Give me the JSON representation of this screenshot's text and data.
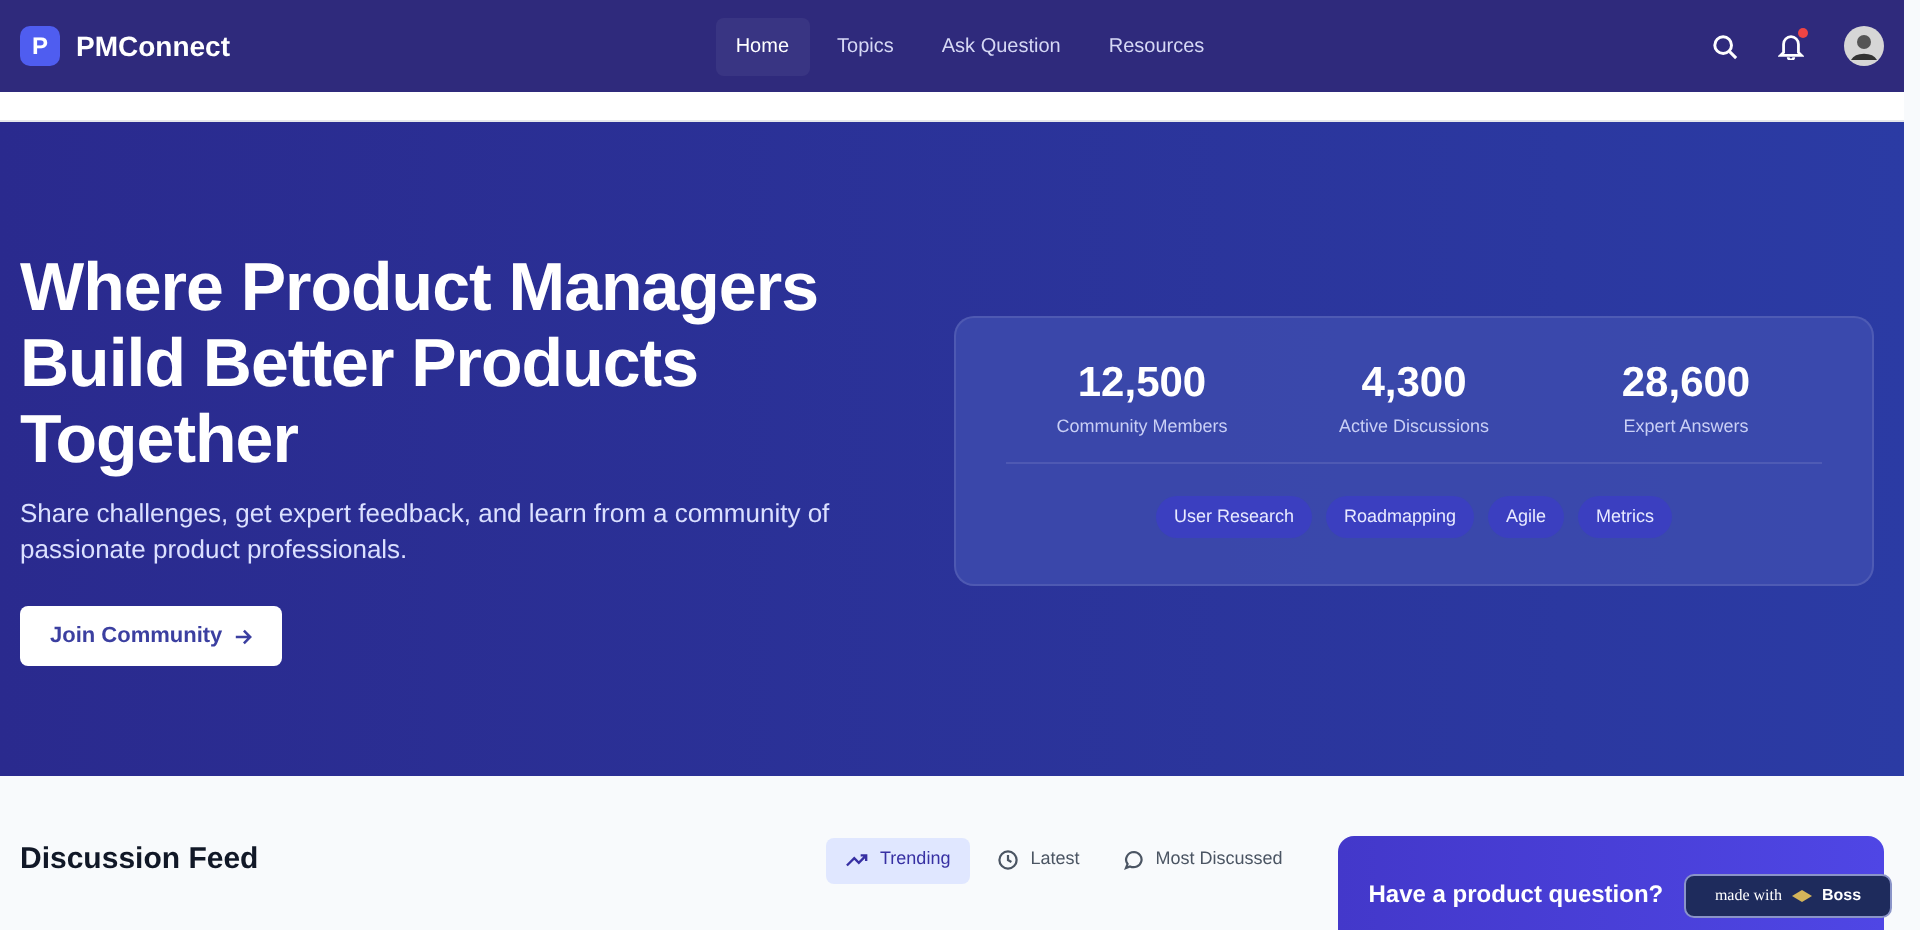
{
  "navbar": {
    "logo_letter": "P",
    "brand": "PMConnect",
    "links": [
      {
        "label": "Home",
        "selected": true
      },
      {
        "label": "Topics",
        "selected": false
      },
      {
        "label": "Ask Question",
        "selected": false
      },
      {
        "label": "Resources",
        "selected": false
      }
    ],
    "notification_unread": true
  },
  "hero": {
    "title": "Where Product Managers Build Better Products Together",
    "subtitle": "Share challenges, get expert feedback, and learn from a community of passionate product professionals.",
    "cta": "Join Community",
    "stats": [
      {
        "value": "12,500",
        "label": "Community Members"
      },
      {
        "value": "4,300",
        "label": "Active Discussions"
      },
      {
        "value": "28,600",
        "label": "Expert Answers"
      }
    ],
    "tags": [
      "User Research",
      "Roadmapping",
      "Agile",
      "Metrics"
    ]
  },
  "feed": {
    "title": "Discussion Feed",
    "filters": [
      {
        "label": "Trending",
        "kind": "trending",
        "selected": true
      },
      {
        "label": "Latest",
        "kind": "latest",
        "selected": false
      },
      {
        "label": "Most Discussed",
        "kind": "discussed",
        "selected": false
      }
    ]
  },
  "ask_card": {
    "title": "Have a product question?"
  },
  "badge": {
    "text": "made with",
    "brand": "Boss"
  }
}
